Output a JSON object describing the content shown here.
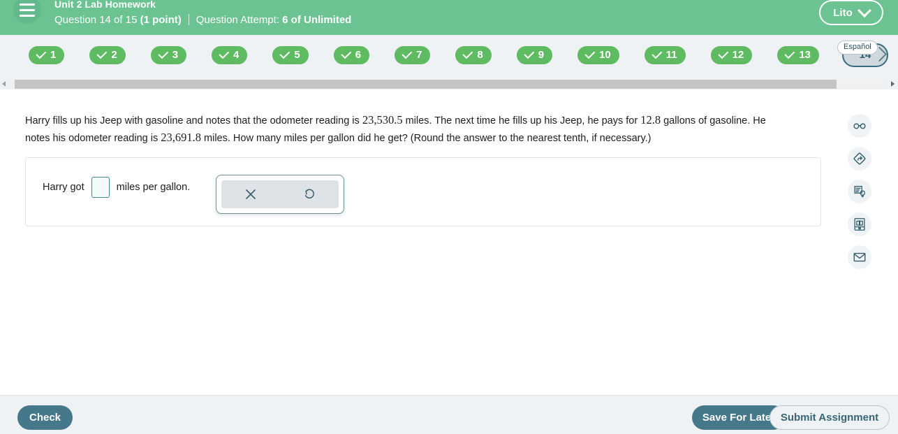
{
  "header": {
    "menu_icon": "hamburger-icon",
    "course_title": "Unit 2 Lab Homework",
    "question_label": "Question 14 of 15 ",
    "question_points": "(1 point)",
    "attempt_label": "Question Attempt: ",
    "attempt_value": "6 of Unlimited",
    "user_name": "Lito",
    "user_caret_icon": "chevron-down-icon",
    "bg_color": "#6bc392"
  },
  "question_nav": {
    "pills": [
      {
        "number": "1",
        "state": "complete"
      },
      {
        "number": "2",
        "state": "complete"
      },
      {
        "number": "3",
        "state": "complete"
      },
      {
        "number": "4",
        "state": "complete"
      },
      {
        "number": "5",
        "state": "complete"
      },
      {
        "number": "6",
        "state": "complete"
      },
      {
        "number": "7",
        "state": "complete"
      },
      {
        "number": "8",
        "state": "complete"
      },
      {
        "number": "9",
        "state": "complete"
      },
      {
        "number": "10",
        "state": "complete"
      },
      {
        "number": "11",
        "state": "complete"
      },
      {
        "number": "12",
        "state": "complete"
      },
      {
        "number": "13",
        "state": "complete"
      },
      {
        "number": "14",
        "state": "current"
      }
    ],
    "next_icon": "chevron-right-icon",
    "spanish_label": "Español",
    "complete_color": "#5fbb62",
    "current_color": "#cfd8dc",
    "scrollbar": {
      "left_arrow_icon": "triangle-left-icon",
      "right_arrow_icon": "triangle-right-icon"
    }
  },
  "question": {
    "line1_a": "Harry fills up his Jeep with gasoline and notes that the odometer reading is ",
    "odometer_start": "23,530.5",
    "line1_b": " miles. The next time he fills up his Jeep, he pays for ",
    "gallons": "12.8",
    "line1_c": " gallons of gasoline. He notes his odometer reading is ",
    "odometer_end": "23,691.8",
    "line1_d": " miles. How many miles per gallon did he get? (Round the answer to the nearest tenth, if necessary.)"
  },
  "answer": {
    "prefix": "Harry got",
    "input_value": "",
    "input_placeholder": "",
    "suffix": "miles per gallon."
  },
  "mini_toolbar": {
    "clear_icon": "close-x-icon",
    "undo_icon": "undo-arrow-icon"
  },
  "tool_rail": {
    "items": [
      {
        "icon": "glasses-icon",
        "name": "reading-tools"
      },
      {
        "icon": "diamond-arrow-icon",
        "name": "skip-question"
      },
      {
        "icon": "worksheet-lightbulb-icon",
        "name": "hint"
      },
      {
        "icon": "ebook-icon",
        "name": "ebook"
      },
      {
        "icon": "envelope-icon",
        "name": "message-instructor"
      }
    ]
  },
  "footer": {
    "check_label": "Check",
    "save_label": "Save For Later",
    "submit_label": "Submit Assignment",
    "primary_color": "#44788a"
  }
}
